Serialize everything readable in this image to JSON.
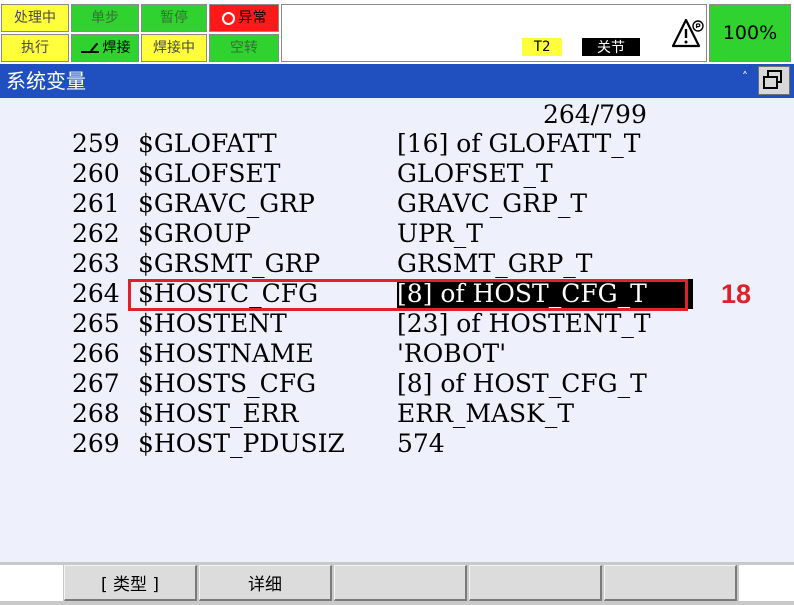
{
  "status_bar": {
    "row1": [
      {
        "label": "处理中",
        "state": "inactive",
        "color": "#ffff3c"
      },
      {
        "label": "单步",
        "state": "inactive",
        "color": "#2fd22f"
      },
      {
        "label": "暂停",
        "state": "inactive",
        "color": "#2fd22f"
      },
      {
        "label": "异常",
        "state": "active",
        "color": "#ff1a1a",
        "icon": "circle-outline-icon"
      }
    ],
    "row2": [
      {
        "label": "执行",
        "state": "inactive",
        "color": "#ffff3c"
      },
      {
        "label": "焊接",
        "state": "active",
        "color": "#2fd22f",
        "icon": "weld-torch-icon"
      },
      {
        "label": "焊接中",
        "state": "inactive",
        "color": "#ffff3c"
      },
      {
        "label": "空转",
        "state": "inactive",
        "color": "#2fd22f"
      }
    ],
    "mode_badge": "T2",
    "state_badge": "关节",
    "warning_icon": "warning-triangle-icon",
    "override": "100%"
  },
  "window": {
    "title": "系统变量",
    "caret_icon": "caret-up-icon",
    "window_button_icon": "restore-window-icon"
  },
  "variables": {
    "page_indicator": "264/799",
    "rows": [
      {
        "number": "259",
        "name": "$GLOFATT",
        "type": "[16] of GLOFATT_T"
      },
      {
        "number": "260",
        "name": "$GLOFSET",
        "type": "GLOFSET_T"
      },
      {
        "number": "261",
        "name": "$GRAVC_GRP",
        "type": "GRAVC_GRP_T"
      },
      {
        "number": "262",
        "name": "$GROUP",
        "type": "UPR_T"
      },
      {
        "number": "263",
        "name": "$GRSMT_GRP",
        "type": "GRSMT_GRP_T"
      },
      {
        "number": "264",
        "name": "$HOSTC_CFG",
        "type": "[8] of HOST_CFG_T",
        "selected": true
      },
      {
        "number": "265",
        "name": "$HOSTENT",
        "type": "[23] of HOSTENT_T"
      },
      {
        "number": "266",
        "name": "$HOSTNAME",
        "type": "'ROBOT'"
      },
      {
        "number": "267",
        "name": "$HOSTS_CFG",
        "type": "[8] of HOST_CFG_T"
      },
      {
        "number": "268",
        "name": "$HOST_ERR",
        "type": "ERR_MASK_T"
      },
      {
        "number": "269",
        "name": "$HOST_PDUSIZ",
        "type": "574"
      }
    ]
  },
  "annotation": {
    "label": "18",
    "color": "#e0202a"
  },
  "function_keys": [
    "[ 类型 ]",
    "详细",
    "",
    "",
    ""
  ],
  "colors": {
    "title_bar": "#2050c0",
    "content_bg": "#eef0fc",
    "status_yellow": "#ffff3c",
    "status_green": "#2fd22f",
    "status_red": "#ff1a1a"
  }
}
